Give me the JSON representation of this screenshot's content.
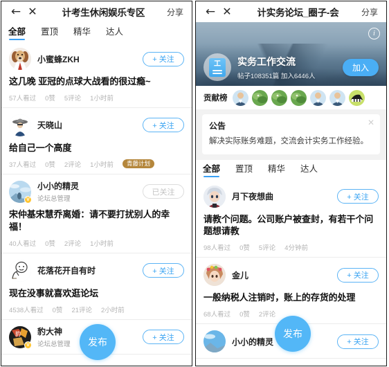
{
  "colors": {
    "accent": "#3ba4f2",
    "fab": "#53b7f7",
    "tag_gold": "#b5873c",
    "followed_gray": "#c3c3c3",
    "join_blue": "#4aaef5"
  },
  "left": {
    "nav": {
      "back_icon": "←",
      "close_icon": "✕",
      "title": "计考生休闲娱乐专区",
      "share_label": "分享"
    },
    "tabs": [
      {
        "label": "全部",
        "active": true
      },
      {
        "label": "置顶",
        "active": false
      },
      {
        "label": "精华",
        "active": false
      },
      {
        "label": "达人",
        "active": false
      }
    ],
    "fab_label": "发布",
    "posts": [
      {
        "user": "小蜜蜂ZKH",
        "role": "",
        "verified": false,
        "follow_label": "+ 关注",
        "followed": false,
        "title": "这几晚 亚冠的点球大战看的很过瘾~",
        "views": "57人看过",
        "likes": "0赞",
        "comments": "5评论",
        "time": "1小时前",
        "tag": ""
      },
      {
        "user": "天晓山",
        "role": "",
        "verified": false,
        "follow_label": "+ 关注",
        "followed": false,
        "title": "给自己一个高度",
        "views": "37人看过",
        "likes": "0赞",
        "comments": "2评论",
        "time": "1小时前",
        "tag": "青藤计划"
      },
      {
        "user": "小小的精灵",
        "role": "论坛总管理",
        "verified": true,
        "follow_label": "已关注",
        "followed": true,
        "title": "宋仲基宋慧乔离婚：请不要打扰别人的幸福！",
        "views": "40人看过",
        "likes": "0赞",
        "comments": "2评论",
        "time": "1小时前",
        "tag": ""
      },
      {
        "user": "花落花开自有时",
        "role": "",
        "verified": false,
        "follow_label": "+ 关注",
        "followed": false,
        "title": "现在没事就喜欢逛论坛",
        "views": "4538人看过",
        "likes": "0赞",
        "comments": "21评论",
        "time": "2小时前",
        "tag": ""
      },
      {
        "user": "豹大神",
        "role": "论坛总管理",
        "verified": true,
        "follow_label": "+ 关注",
        "followed": false,
        "title": "",
        "views": "",
        "likes": "",
        "comments": "",
        "time": "",
        "tag": ""
      }
    ]
  },
  "right": {
    "nav": {
      "back_icon": "←",
      "close_icon": "✕",
      "title": "计实务论坛_圈子-会",
      "share_label": "分享"
    },
    "banner": {
      "info_icon": "i",
      "club_name": "实务工作交流",
      "club_stats": "帖子108351篇  加入6446人",
      "join_label": "加入"
    },
    "contributors": {
      "label": "贡献榜",
      "avatars": [
        "avatar-suit-1",
        "avatar-leaf-1",
        "avatar-leaf-2",
        "avatar-leaf-3",
        "avatar-suit-2",
        "avatar-suit-3",
        "avatar-piano"
      ]
    },
    "notice": {
      "title": "公告",
      "body": "解决实际账务难题，交流会计实务工作经验。",
      "close_icon": "✕"
    },
    "tabs": [
      {
        "label": "全部",
        "active": true
      },
      {
        "label": "置顶",
        "active": false
      },
      {
        "label": "精华",
        "active": false
      },
      {
        "label": "达人",
        "active": false
      }
    ],
    "fab_label": "发布",
    "posts": [
      {
        "user": "月下夜想曲",
        "role": "",
        "verified": false,
        "follow_label": "+ 关注",
        "followed": false,
        "title": "请教个问题。公司账户被查封，有若干个问题想请教",
        "views": "98人看过",
        "likes": "0赞",
        "comments": "5评论",
        "time": "4分钟前",
        "tag": ""
      },
      {
        "user": "金儿",
        "role": "",
        "verified": false,
        "follow_label": "+ 关注",
        "followed": false,
        "title": "一般纳税人注销时，账上的存货的处理",
        "views": "68人看过",
        "likes": "0赞",
        "comments": "2评论",
        "time": "",
        "tag": ""
      },
      {
        "user": "小小的精灵",
        "role": "",
        "verified": false,
        "follow_label": "+ 关注",
        "followed": false,
        "title": "",
        "views": "",
        "likes": "",
        "comments": "",
        "time": "",
        "tag": ""
      }
    ]
  }
}
